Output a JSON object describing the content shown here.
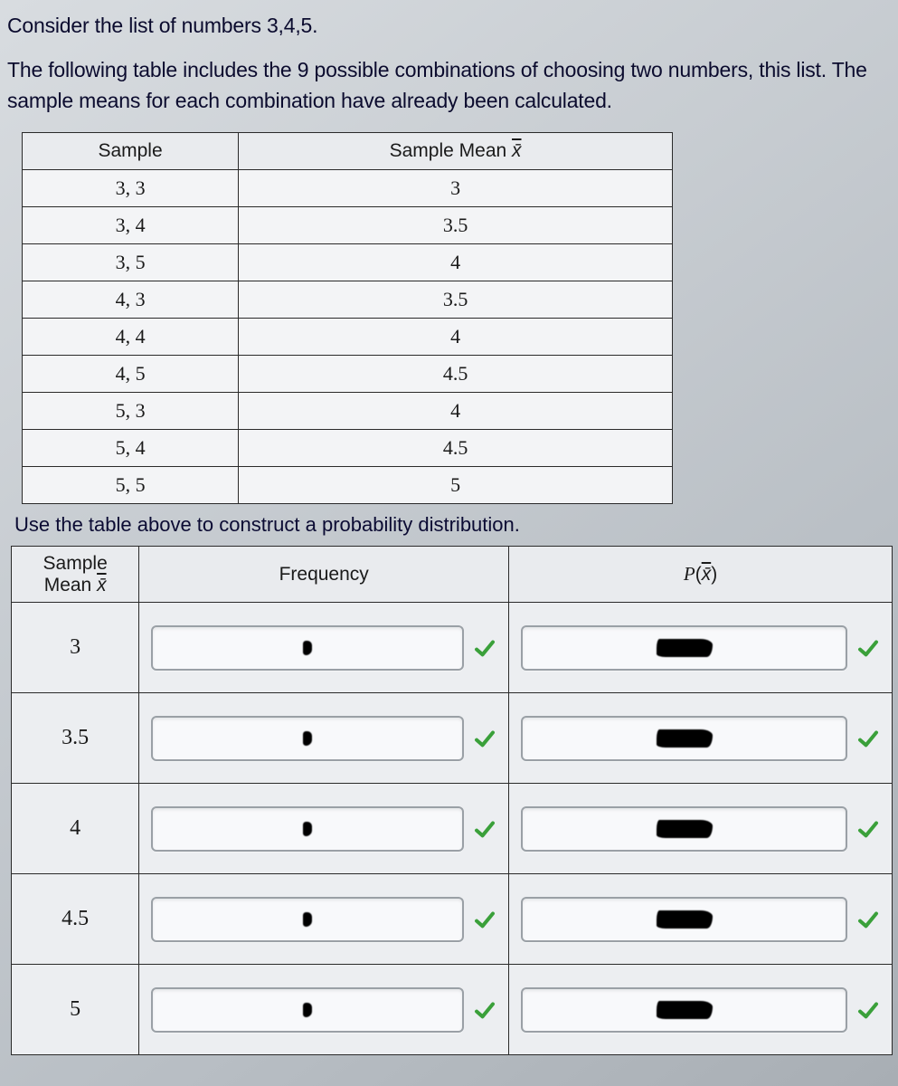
{
  "intro": {
    "line1": "Consider the list of numbers 3,4,5.",
    "line2": "The following table includes the 9 possible combinations of choosing two numbers, this list. The sample means for each combination have already been calculated."
  },
  "table1": {
    "headers": {
      "sample": "Sample",
      "mean": "Sample Mean "
    },
    "xbar_glyph": "x̄",
    "rows": [
      {
        "sample": "3, 3",
        "mean": "3"
      },
      {
        "sample": "3, 4",
        "mean": "3.5"
      },
      {
        "sample": "3, 5",
        "mean": "4"
      },
      {
        "sample": "4, 3",
        "mean": "3.5"
      },
      {
        "sample": "4, 4",
        "mean": "4"
      },
      {
        "sample": "4, 5",
        "mean": "4.5"
      },
      {
        "sample": "5, 3",
        "mean": "4"
      },
      {
        "sample": "5, 4",
        "mean": "4.5"
      },
      {
        "sample": "5, 5",
        "mean": "5"
      }
    ]
  },
  "instruction": "Use the table above to construct a probability distribution.",
  "table2": {
    "headers": {
      "mean_label_a": "Sample",
      "mean_label_b": "Mean ",
      "xbar_glyph": "x̄",
      "freq": "Frequency",
      "pxbar": "P(x̄)"
    },
    "rows": [
      {
        "mean": "3",
        "freq_correct": true,
        "p_correct": true
      },
      {
        "mean": "3.5",
        "freq_correct": true,
        "p_correct": true
      },
      {
        "mean": "4",
        "freq_correct": true,
        "p_correct": true
      },
      {
        "mean": "4.5",
        "freq_correct": true,
        "p_correct": true
      },
      {
        "mean": "5",
        "freq_correct": true,
        "p_correct": true
      }
    ]
  },
  "icons": {
    "check": "check-icon"
  }
}
